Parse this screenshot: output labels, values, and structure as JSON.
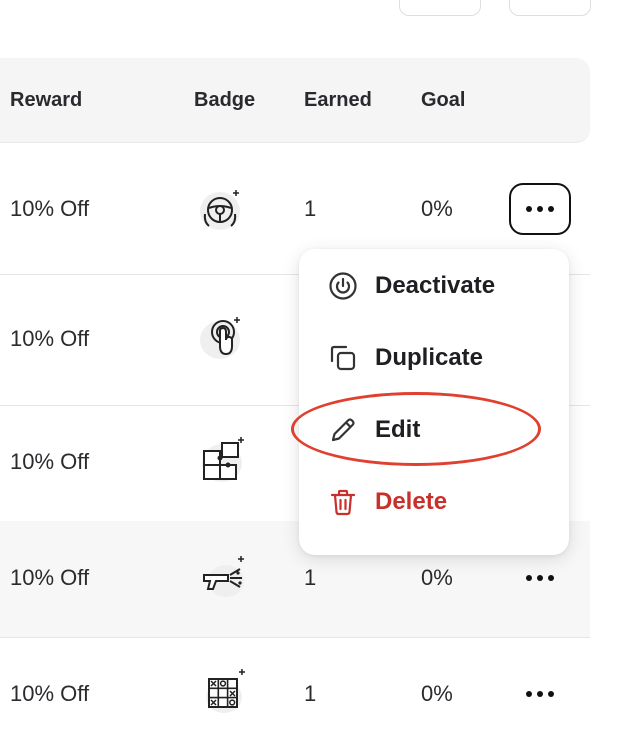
{
  "table": {
    "headers": {
      "reward": "Reward",
      "badge": "Badge",
      "earned": "Earned",
      "goal": "Goal"
    },
    "rows": [
      {
        "reward": "10% Off",
        "badge_icon": "steering-wheel-icon",
        "earned": "1",
        "goal": "0%",
        "menu_open": true
      },
      {
        "reward": "10% Off",
        "badge_icon": "tap-finger-icon",
        "earned": "",
        "goal": "",
        "menu_open": false
      },
      {
        "reward": "10% Off",
        "badge_icon": "puzzle-icon",
        "earned": "",
        "goal": "",
        "menu_open": false
      },
      {
        "reward": "10% Off",
        "badge_icon": "laser-gun-icon",
        "earned": "1",
        "goal": "0%",
        "menu_open": false
      },
      {
        "reward": "10% Off",
        "badge_icon": "tic-tac-toe-icon",
        "earned": "1",
        "goal": "0%",
        "menu_open": false
      }
    ]
  },
  "menu": {
    "items": [
      {
        "label": "Deactivate",
        "icon": "power-icon"
      },
      {
        "label": "Duplicate",
        "icon": "duplicate-icon"
      },
      {
        "label": "Edit",
        "icon": "pencil-icon"
      },
      {
        "label": "Delete",
        "icon": "trash-icon"
      }
    ]
  },
  "colors": {
    "header_bg": "#f5f5f5",
    "danger": "#c8302b",
    "annotation": "#e0402f"
  }
}
